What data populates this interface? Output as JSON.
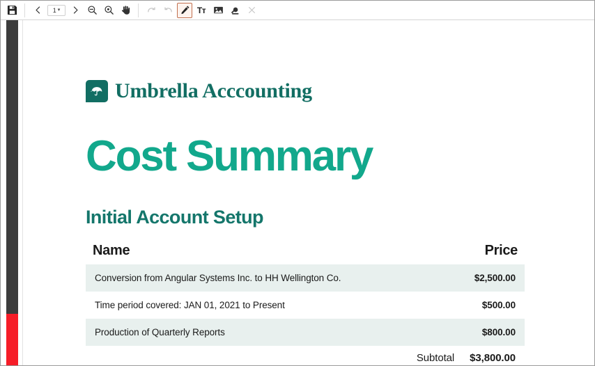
{
  "toolbar": {
    "buttons": [
      {
        "id": "save",
        "icon": "save-icon",
        "label": "",
        "state": "enabled"
      },
      {
        "id": "prev-page",
        "icon": "chevron-left-icon",
        "label": "",
        "state": "enabled"
      },
      {
        "id": "next-page",
        "icon": "chevron-right-icon",
        "label": "",
        "state": "enabled"
      },
      {
        "id": "zoom-out",
        "icon": "zoom-out-icon",
        "label": "",
        "state": "enabled"
      },
      {
        "id": "zoom-in",
        "icon": "zoom-in-icon",
        "label": "",
        "state": "enabled"
      },
      {
        "id": "pan",
        "icon": "hand-icon",
        "label": "",
        "state": "enabled"
      },
      {
        "id": "redo",
        "icon": "redo-icon",
        "label": "",
        "state": "disabled"
      },
      {
        "id": "undo",
        "icon": "undo-icon",
        "label": "",
        "state": "disabled"
      },
      {
        "id": "draw",
        "icon": "pencil-icon",
        "label": "",
        "state": "active"
      },
      {
        "id": "text",
        "icon": "text-tool-icon",
        "label": "Tт",
        "state": "enabled"
      },
      {
        "id": "image",
        "icon": "image-icon",
        "label": "",
        "state": "enabled"
      },
      {
        "id": "stamp",
        "icon": "stamp-icon",
        "label": "",
        "state": "enabled"
      },
      {
        "id": "close",
        "icon": "close-icon",
        "label": "",
        "state": "disabled"
      }
    ],
    "page_number": "1",
    "page_caret": "▾",
    "text_tool_label": "Tт",
    "active_tool_accent": "#c2704f"
  },
  "sidebar": {
    "rail_color": "#3c3c3c",
    "marker_color": "#f61d28",
    "marker_top_pct": 85,
    "marker_height_pct": 15
  },
  "document": {
    "brand": {
      "mark_icon": "umbrella-icon",
      "mark_color": "#126e63",
      "name": "Umbrella Acccounting"
    },
    "title": "Cost Summary",
    "title_color": "#12a88c",
    "section_title": "Initial Account Setup",
    "section_title_color": "#14766b",
    "table": {
      "columns": {
        "name": "Name",
        "price": "Price"
      },
      "rows": [
        {
          "name": "Conversion from Angular Systems Inc. to HH Wellington Co.",
          "price": "$2,500.00",
          "shaded": true
        },
        {
          "name": "Time period covered: JAN 01, 2021 to Present",
          "price": "$500.00",
          "shaded": false
        },
        {
          "name": "Production of Quarterly Reports",
          "price": "$800.00",
          "shaded": true
        }
      ],
      "subtotal": {
        "label": "Subtotal",
        "value": "$3,800.00"
      }
    }
  }
}
